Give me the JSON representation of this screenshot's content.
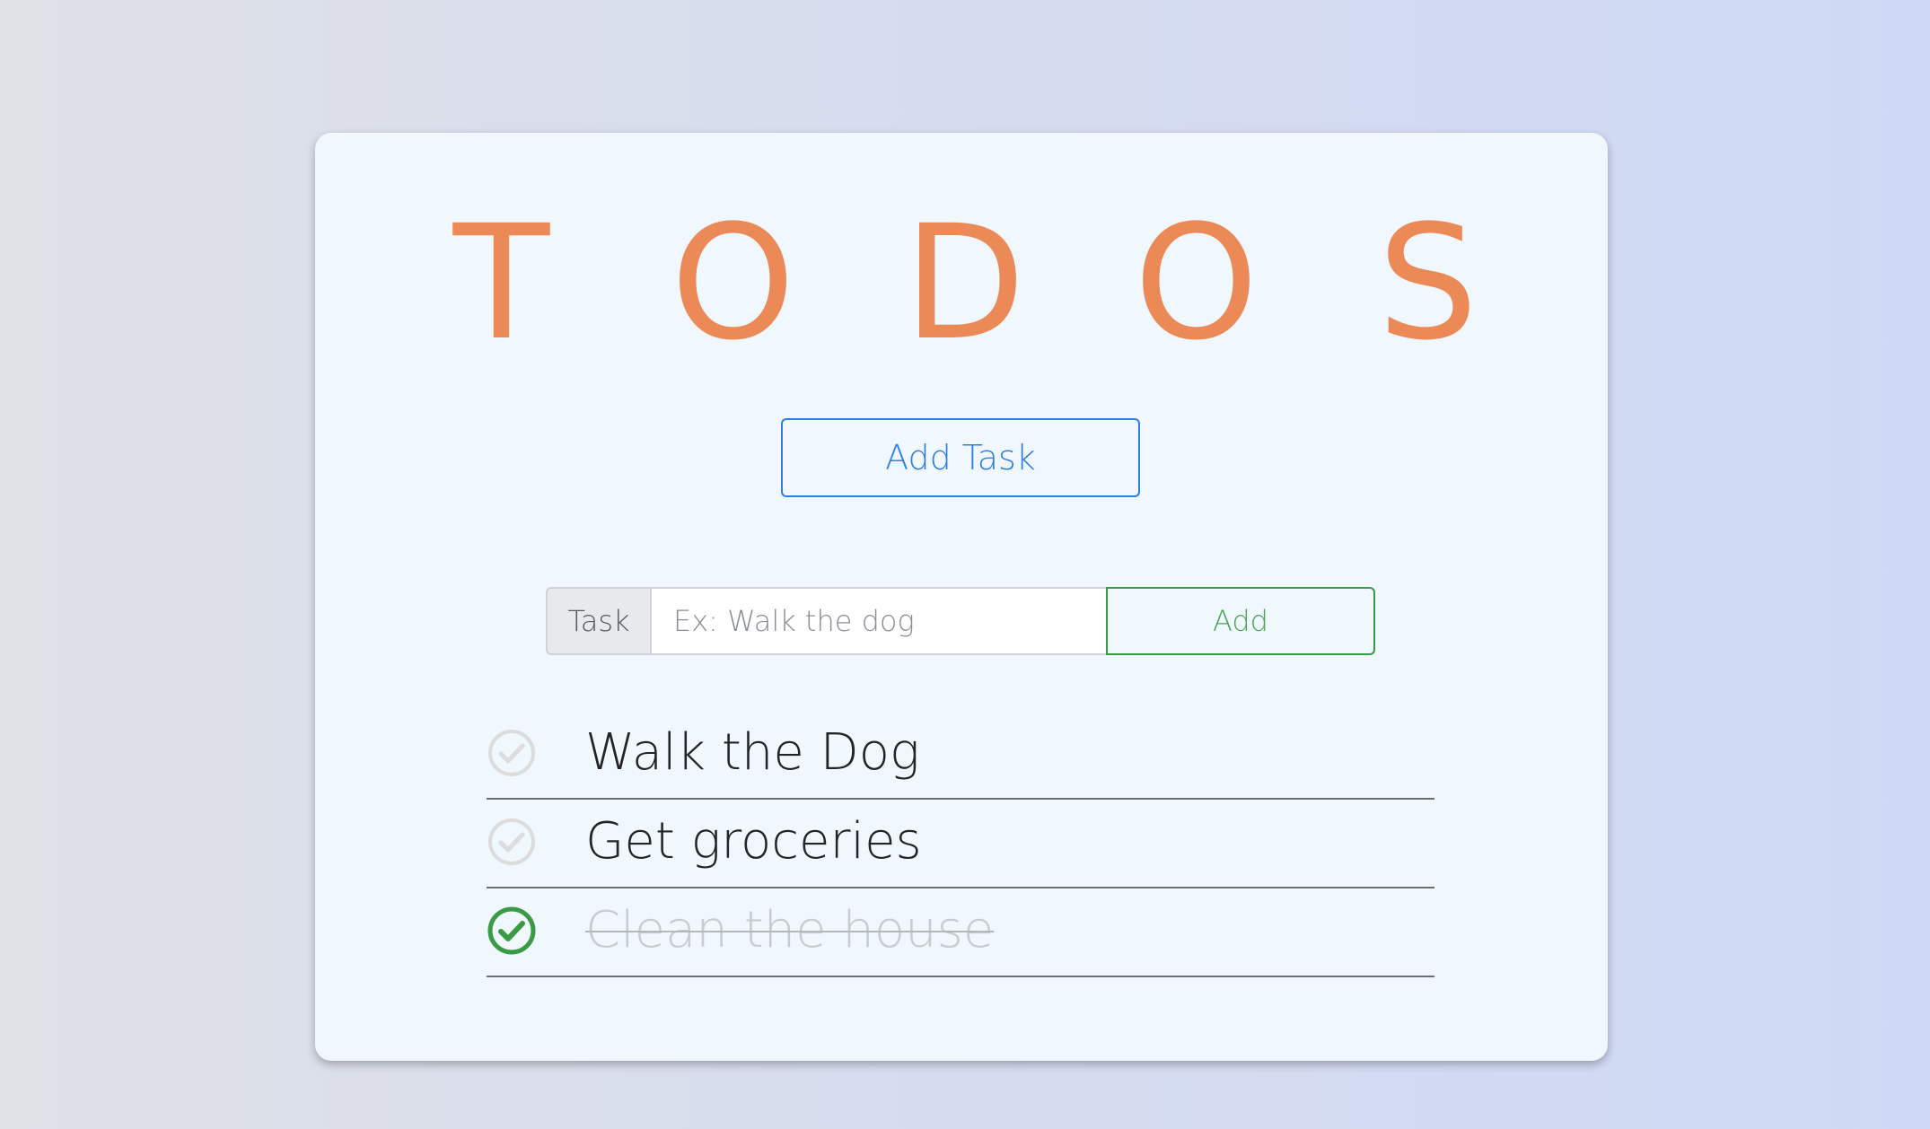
{
  "app": {
    "title_letters": [
      "T",
      "O",
      "D",
      "O",
      "S"
    ]
  },
  "add_task_button": {
    "label": "Add Task"
  },
  "task_form": {
    "label": "Task",
    "placeholder": "Ex: Walk the dog",
    "value": "",
    "submit_label": "Add"
  },
  "todos": [
    {
      "text": "Walk the Dog",
      "completed": false
    },
    {
      "text": "Get groceries",
      "completed": false
    },
    {
      "text": "Clean the house",
      "completed": true
    }
  ],
  "colors": {
    "title": "#ec8a57",
    "add_task_border": "#2f7fe0",
    "add_button": "#3a9a45",
    "check_incomplete": "#dcdcdc",
    "check_complete": "#3a9a45",
    "card_background": "#f0f7fd"
  },
  "icons": {
    "check_incomplete": "check-circle-outline-icon",
    "check_complete": "check-circle-icon"
  }
}
